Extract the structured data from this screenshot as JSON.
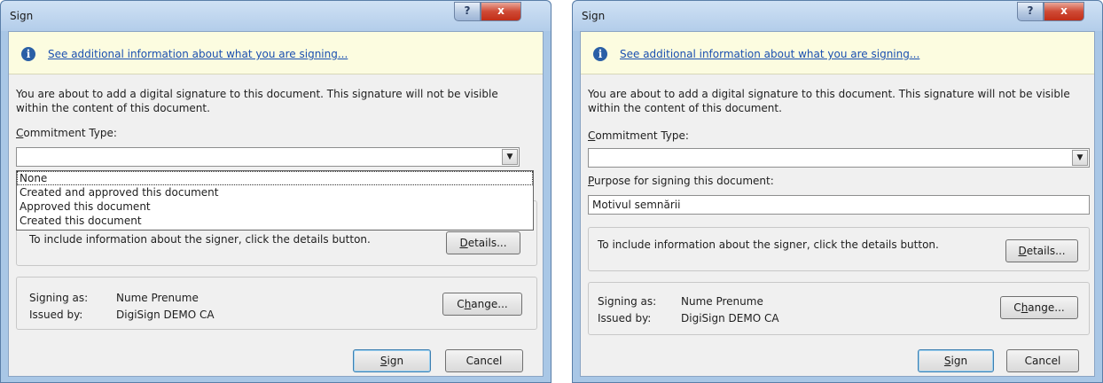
{
  "dialog_left": {
    "title": "Sign",
    "help_label": "?",
    "close_label": "x",
    "info_link": "See additional information about what you are signing...",
    "description": "You are about to add a digital signature to this document. This signature will not be visible within the content of this document.",
    "commitment_label_access": "C",
    "commitment_label_rest": "ommitment Type:",
    "commitment_value": "",
    "dropdown_options": [
      "None",
      "Created and approved this document",
      "Approved this document",
      "Created this document"
    ],
    "details_text": "To include information about the signer, click the details button.",
    "details_access": "D",
    "details_rest": "etails...",
    "signing_as_label": "Signing as:",
    "signing_as_value": "Nume Prenume",
    "issued_by_label": "Issued by:",
    "issued_by_value": "DigiSign DEMO CA",
    "change_pre": "C",
    "change_access": "h",
    "change_rest": "ange...",
    "sign_access": "S",
    "sign_rest": "ign",
    "cancel_label": "Cancel"
  },
  "dialog_right": {
    "title": "Sign",
    "help_label": "?",
    "close_label": "x",
    "info_link": "See additional information about what you are signing...",
    "description": "You are about to add a digital signature to this document. This signature will not be visible within the content of this document.",
    "commitment_label_access": "C",
    "commitment_label_rest": "ommitment Type:",
    "commitment_value": "",
    "purpose_access": "P",
    "purpose_rest": "urpose for signing this document:",
    "purpose_value": "Motivul semnării",
    "details_text": "To include information about the signer, click the details button.",
    "details_access": "D",
    "details_rest": "etails...",
    "signing_as_label": "Signing as:",
    "signing_as_value": "Nume Prenume",
    "issued_by_label": "Issued by:",
    "issued_by_value": "DigiSign DEMO CA",
    "change_pre": "C",
    "change_access": "h",
    "change_rest": "ange...",
    "sign_access": "S",
    "sign_rest": "ign",
    "cancel_label": "Cancel"
  },
  "colors": {
    "title_bar": "#b3cdea",
    "info_bar": "#fcfce0",
    "link": "#1a4fb0",
    "close_button": "#c22e17",
    "info_icon": "#2a5fa6"
  }
}
